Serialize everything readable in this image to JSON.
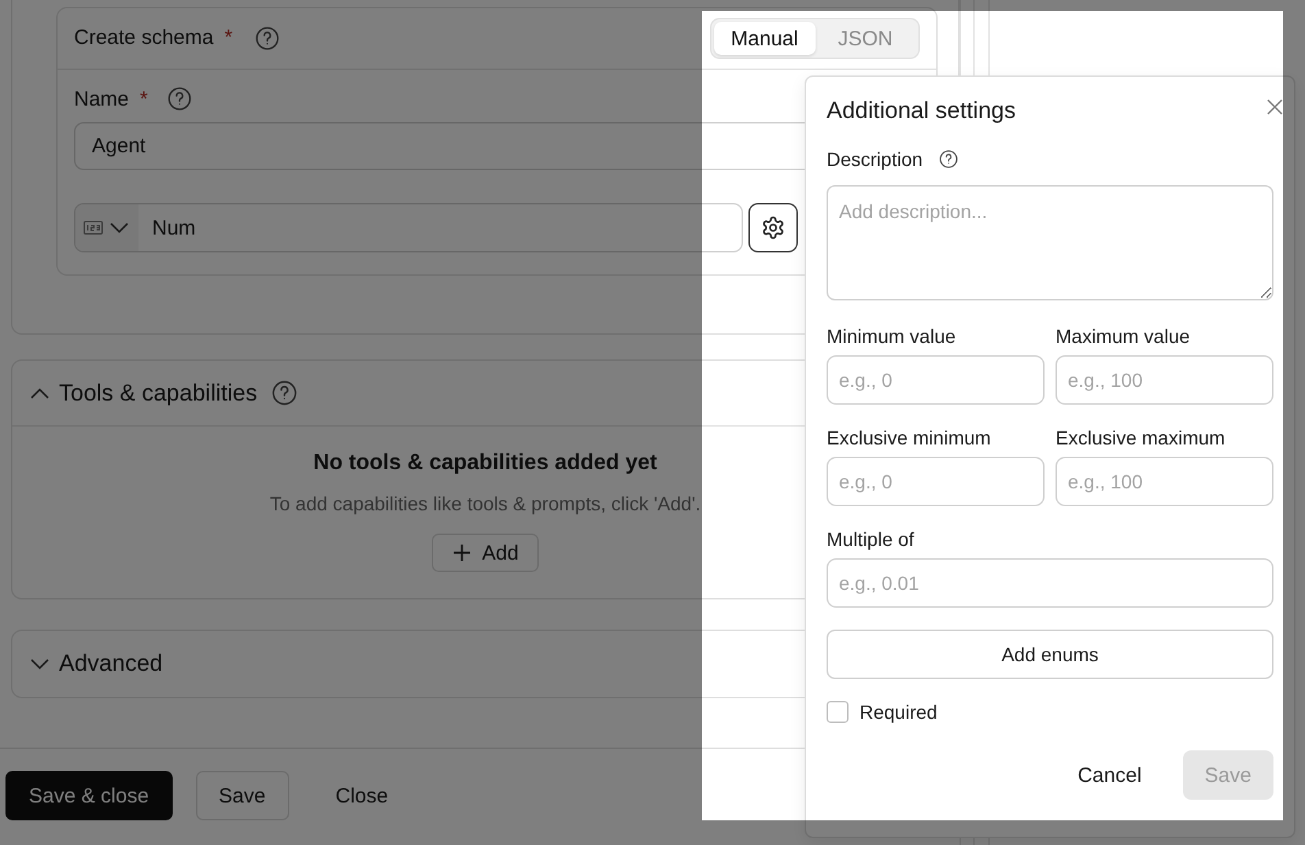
{
  "schema_card": {
    "title": "Create schema",
    "required_mark": "*",
    "mode_tabs": [
      {
        "label": "Manual",
        "selected": true
      },
      {
        "label": "JSON",
        "selected": false
      }
    ],
    "name_field": {
      "label": "Name",
      "required_mark": "*",
      "value": "Agent"
    },
    "property_row": {
      "value": "Num"
    }
  },
  "tools_section": {
    "title": "Tools & capabilities",
    "expanded": true,
    "empty_title": "No tools & capabilities added yet",
    "empty_hint": "To add capabilities like tools & prompts, click 'Add'.",
    "add_button": "Add"
  },
  "advanced_section": {
    "title": "Advanced",
    "expanded": false
  },
  "footer": {
    "buttons": [
      {
        "label": "Save & close",
        "kind": "primary"
      },
      {
        "label": "Save",
        "kind": "outline"
      },
      {
        "label": "Close",
        "kind": "ghost"
      }
    ]
  },
  "popover": {
    "title": "Additional settings",
    "description": {
      "label": "Description",
      "placeholder": "Add description..."
    },
    "fields": [
      {
        "label": "Minimum value",
        "placeholder": "e.g., 0",
        "wide": false
      },
      {
        "label": "Maximum value",
        "placeholder": "e.g., 100",
        "wide": false
      },
      {
        "label": "Exclusive minimum",
        "placeholder": "e.g., 0",
        "wide": false
      },
      {
        "label": "Exclusive maximum",
        "placeholder": "e.g., 100",
        "wide": false
      },
      {
        "label": "Multiple of",
        "placeholder": "e.g., 0.01",
        "wide": true
      }
    ],
    "add_enums": "Add enums",
    "required": {
      "label": "Required",
      "checked": false
    },
    "buttons": [
      {
        "label": "Cancel",
        "kind": "ghost",
        "disabled": false
      },
      {
        "label": "Save",
        "kind": "filled",
        "disabled": true
      }
    ]
  }
}
